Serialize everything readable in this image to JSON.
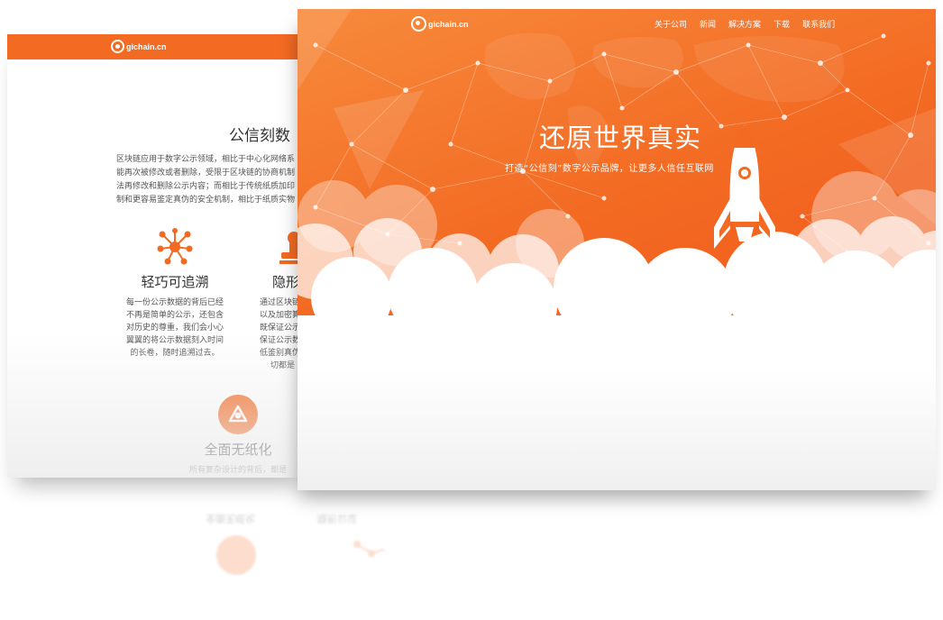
{
  "back_page": {
    "logo_text": "gichain.cn",
    "section_title": "公信刻数",
    "paragraph_lines": [
      "区块链应用于数字公示领域，相比于中心化网络系",
      "能再次被修改或者删除，受限于区块链的协商机制",
      "法再修改和删除公示内容；而相比于传统纸质加印",
      "制和更容易鉴定真伪的安全机制，相比于纸质实物"
    ],
    "features": [
      {
        "icon": "network-nodes-icon",
        "title": "轻巧可追溯",
        "desc_lines": [
          "每一份公示数据的背后已经",
          "不再是简单的公示，还包含",
          "对历史的尊重，我们会小心",
          "翼翼的将公示数据刻入时间",
          "的长卷，随时追溯过去。"
        ]
      },
      {
        "icon": "stamp-icon",
        "title": "隐形",
        "desc_lines": [
          "通过区块链",
          "以及加密算",
          "既保证公示",
          "保证公示数",
          "低鉴别真伪",
          "切都是"
        ]
      },
      {
        "icon": "recycle-triangle-icon",
        "title": "全面无纸化",
        "desc_lines": [
          "所有复杂设计的背后，都是"
        ]
      }
    ],
    "reflection_texts": [
      "全面无纸化",
      "隐形公证"
    ]
  },
  "front_page": {
    "logo_text": "gichain.cn",
    "menu": [
      "关于公司",
      "新闻",
      "解决方案",
      "下载",
      "联系我们"
    ],
    "hero_title": "还原世界真实",
    "hero_subtitle": "打造“公信刻”数字公示品牌，让更多人信任互联网",
    "icons": [
      "rocket-icon",
      "chevron-down-icon"
    ]
  },
  "colors": {
    "brand_orange": "#f36a23",
    "hero_light": "#f78a3c",
    "text_dark": "#333333",
    "white": "#ffffff"
  }
}
